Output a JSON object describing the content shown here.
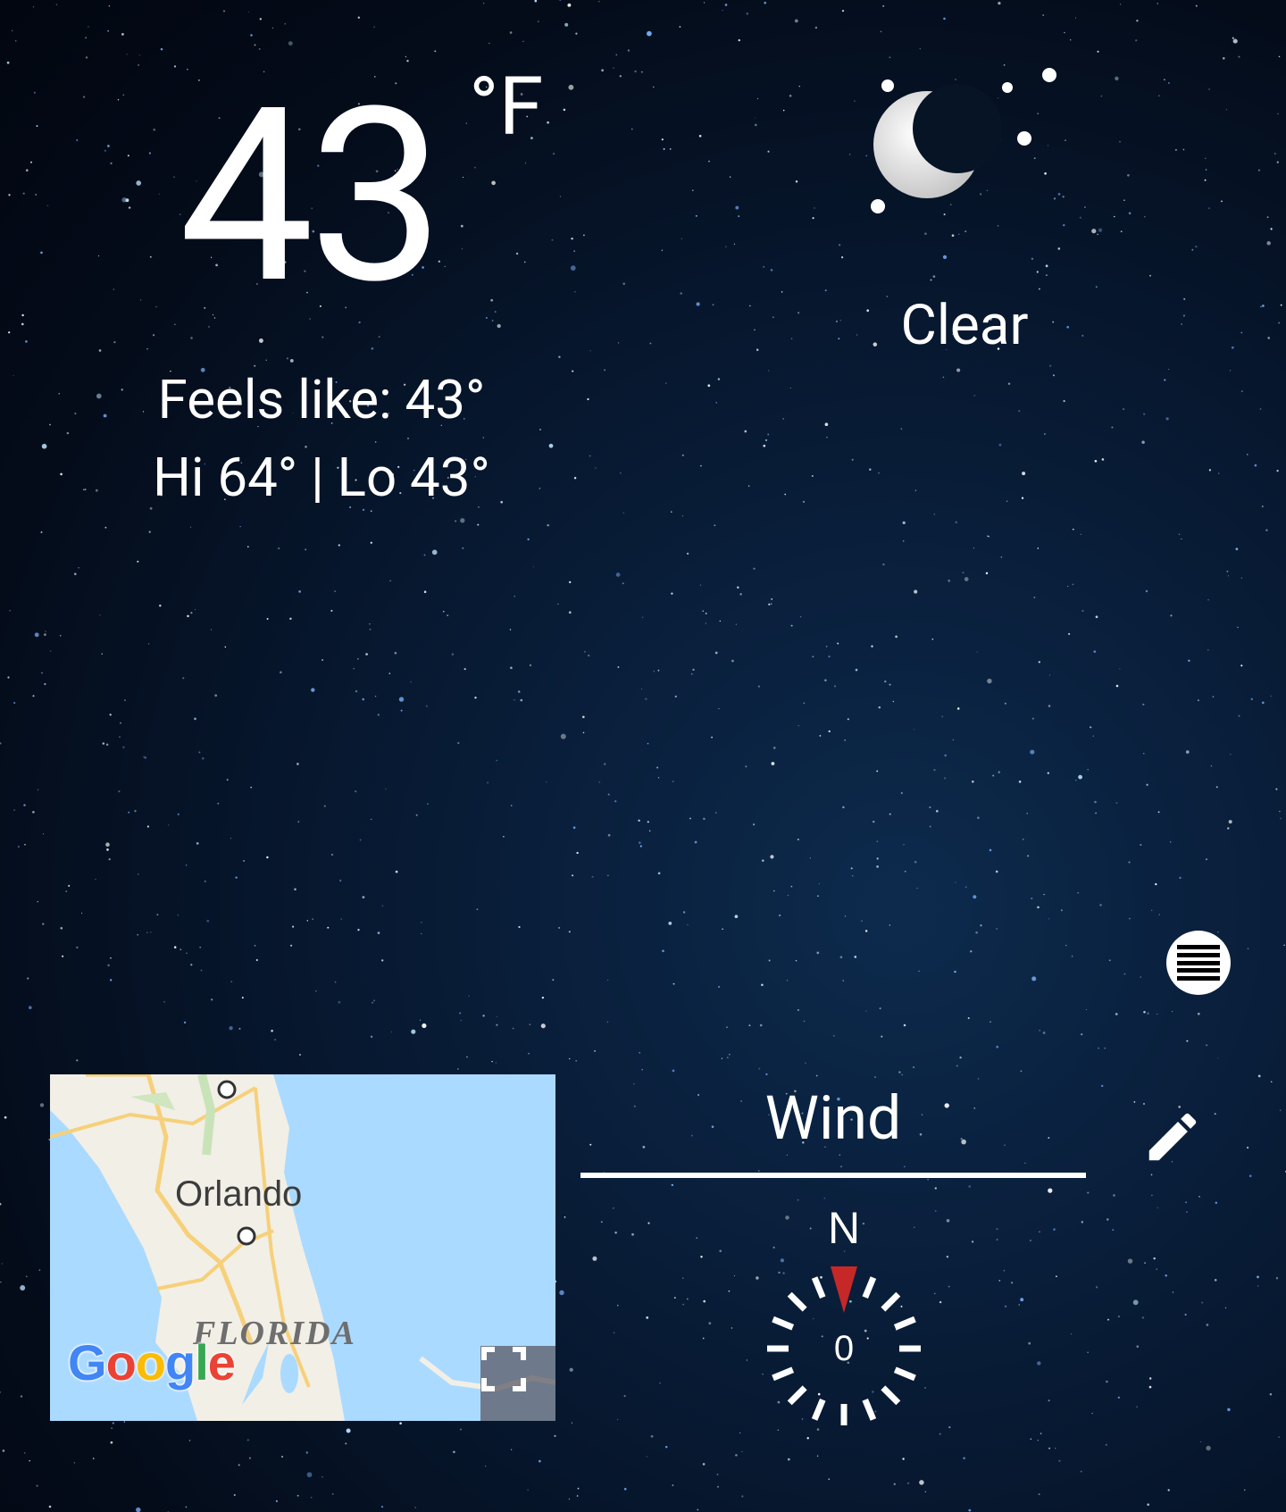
{
  "current": {
    "temperature": "43",
    "unit": "°F",
    "feels_like": "Feels like: 43°",
    "hi_lo": "Hi 64° | Lo 43°",
    "condition": "Clear",
    "condition_icon": "moon-stars-icon"
  },
  "map": {
    "city_label": "Orlando",
    "state_label": "FLORIDA",
    "logo": "Google",
    "expand_icon": "fullscreen-icon"
  },
  "wind": {
    "title": "Wind",
    "edit_icon": "pencil-icon",
    "direction_label": "N",
    "speed": "0"
  },
  "menu_icon": "list-menu-icon",
  "colors": {
    "compass_needle": "#c62828",
    "map_water": "#aadaff",
    "map_land": "#f2efe6"
  }
}
